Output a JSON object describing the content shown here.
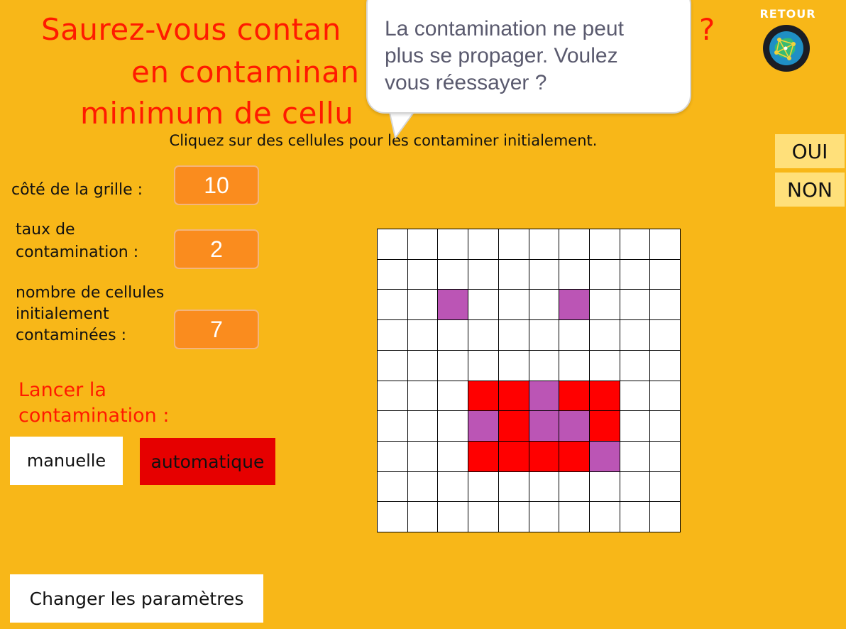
{
  "title": {
    "line1_visible_left": "Saurez-vous contan",
    "line1_visible_right": "?",
    "line2_visible": "en contaminan",
    "line3_visible": "minimum de cellu"
  },
  "instruction": "Cliquez sur des cellules pour les contaminer initialement.",
  "params": {
    "grid_side_label": "côté de la grille :",
    "grid_side_value": "10",
    "rate_label_1": "taux de",
    "rate_label_2": "contamination :",
    "rate_value": "2",
    "count_label_1": "nombre de cellules",
    "count_label_2": "initialement",
    "count_label_3": "contaminées :",
    "count_value": "7"
  },
  "launch": {
    "label_1": "Lancer la",
    "label_2": "contamination :",
    "manual": "manuelle",
    "auto": "automatique"
  },
  "change_params": "Changer les paramètres",
  "dialog": {
    "line1": "La contamination ne peut",
    "line2": "plus se propager. Voulez",
    "line3": "vous réessayer ?",
    "yes": "OUI",
    "no": "NON"
  },
  "retour": "RETOUR",
  "grid": {
    "size": 10,
    "rows": [
      "..........",
      "..........",
      "..P...P...",
      "..........",
      "..........",
      "...RRPRR..",
      "...PRPPR..",
      "...RRRRP..",
      "..........",
      ".........."
    ],
    "colors": {
      "R": "#ff0000",
      "P": "#bb55b5",
      ".": "#ffffff"
    }
  },
  "colors": {
    "background": "#f8b718",
    "title": "#ff1a00",
    "value_box": "#fa8c1e",
    "auto_button": "#e60000",
    "side_button": "#ffe07a"
  }
}
